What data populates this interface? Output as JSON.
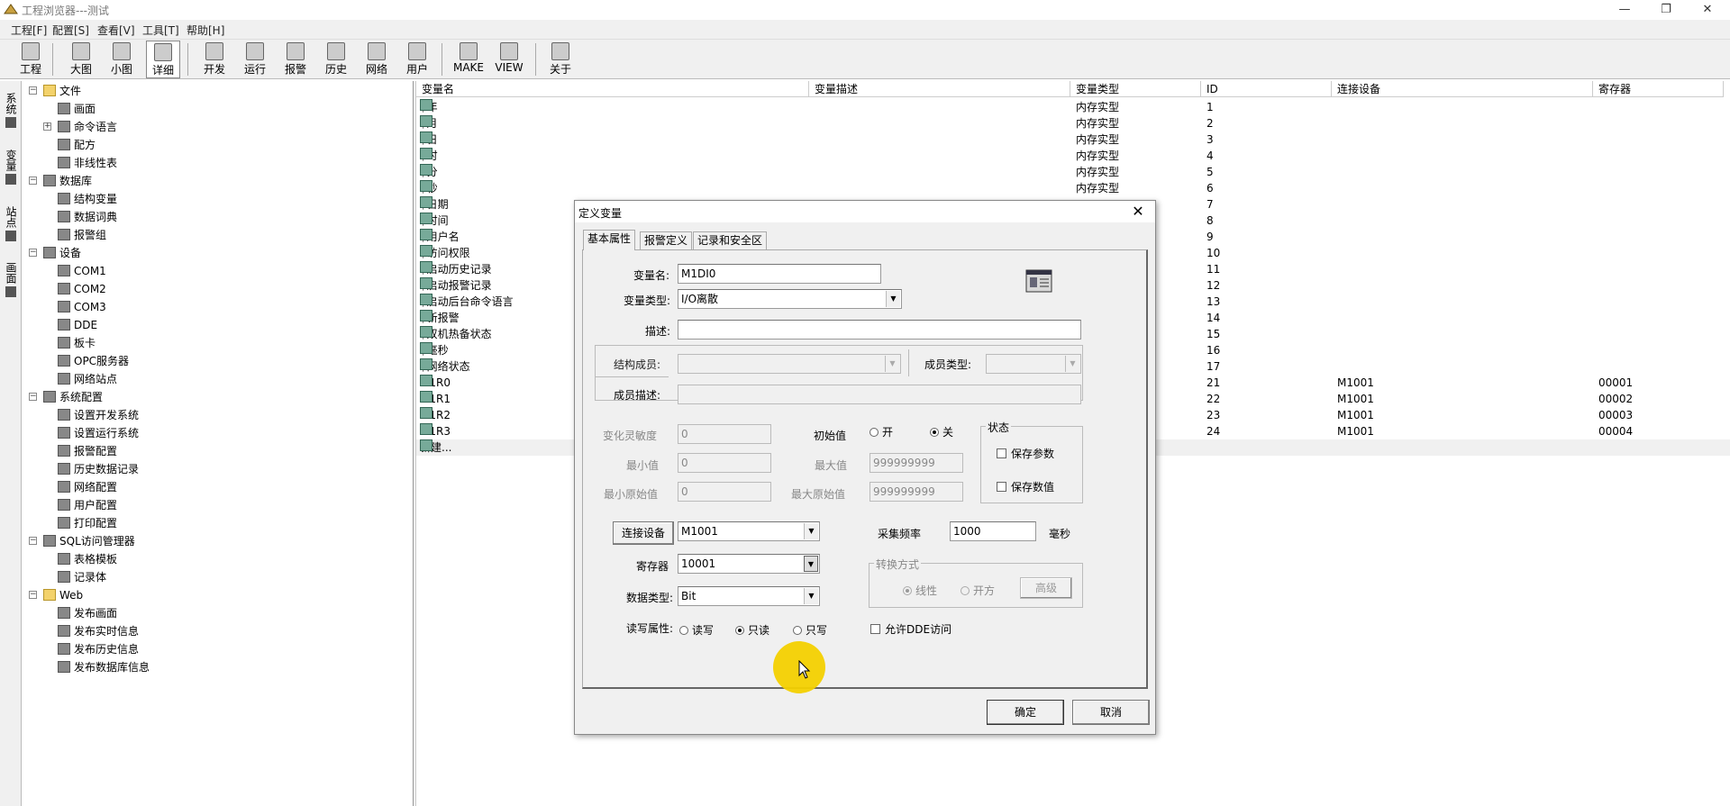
{
  "window": {
    "title": "工程浏览器---测试",
    "controls": [
      "minimize",
      "restore",
      "close"
    ]
  },
  "menu": [
    "工程[F]",
    "配置[S]",
    "查看[V]",
    "工具[T]",
    "帮助[H]"
  ],
  "toolbar": [
    "工程",
    "大图",
    "小图",
    "详细",
    "开发",
    "运行",
    "报警",
    "历史",
    "网络",
    "用户",
    "MAKE",
    "VIEW",
    "关于"
  ],
  "toolbar_active": "详细",
  "vtabs": [
    "系统",
    "变量",
    "站点",
    "画面"
  ],
  "tree": [
    {
      "label": "文件",
      "level": 0,
      "expander": "−",
      "icon": "folder-icon"
    },
    {
      "label": "画面",
      "level": 1,
      "icon": "screen-icon"
    },
    {
      "label": "命令语言",
      "level": 1,
      "expander": "+",
      "icon": "script-icon"
    },
    {
      "label": "配方",
      "level": 1,
      "icon": "recipe-icon"
    },
    {
      "label": "非线性表",
      "level": 1,
      "icon": "table-icon"
    },
    {
      "label": "数据库",
      "level": 0,
      "expander": "−",
      "icon": "database-icon"
    },
    {
      "label": "结构变量",
      "level": 1,
      "icon": "struct-icon"
    },
    {
      "label": "数据词典",
      "level": 1,
      "icon": "dictionary-icon"
    },
    {
      "label": "报警组",
      "level": 1,
      "icon": "alarm-group-icon"
    },
    {
      "label": "设备",
      "level": 0,
      "expander": "−",
      "icon": "device-icon"
    },
    {
      "label": "COM1",
      "level": 1,
      "icon": "port-icon"
    },
    {
      "label": "COM2",
      "level": 1,
      "icon": "port-icon"
    },
    {
      "label": "COM3",
      "level": 1,
      "icon": "port-icon"
    },
    {
      "label": "DDE",
      "level": 1,
      "icon": "dde-icon"
    },
    {
      "label": "板卡",
      "level": 1,
      "icon": "board-icon"
    },
    {
      "label": "OPC服务器",
      "level": 1,
      "icon": "opc-icon"
    },
    {
      "label": "网络站点",
      "level": 1,
      "icon": "network-icon"
    },
    {
      "label": "系统配置",
      "level": 0,
      "expander": "−",
      "icon": "tools-icon"
    },
    {
      "label": "设置开发系统",
      "level": 1,
      "icon": "dev-config-icon"
    },
    {
      "label": "设置运行系统",
      "level": 1,
      "icon": "run-config-icon"
    },
    {
      "label": "报警配置",
      "level": 1,
      "icon": "alarm-config-icon"
    },
    {
      "label": "历史数据记录",
      "level": 1,
      "icon": "history-icon"
    },
    {
      "label": "网络配置",
      "level": 1,
      "icon": "network-config-icon"
    },
    {
      "label": "用户配置",
      "level": 1,
      "icon": "user-icon"
    },
    {
      "label": "打印配置",
      "level": 1,
      "icon": "printer-icon"
    },
    {
      "label": "SQL访问管理器",
      "level": 0,
      "expander": "−",
      "icon": "sql-icon"
    },
    {
      "label": "表格模板",
      "level": 1,
      "icon": "template-icon"
    },
    {
      "label": "记录体",
      "level": 1,
      "icon": "record-icon"
    },
    {
      "label": "Web",
      "level": 0,
      "expander": "−",
      "icon": "folder-icon"
    },
    {
      "label": "发布画面",
      "level": 1,
      "icon": "publish-icon"
    },
    {
      "label": "发布实时信息",
      "level": 1,
      "icon": "publish-icon"
    },
    {
      "label": "发布历史信息",
      "level": 1,
      "icon": "publish-icon"
    },
    {
      "label": "发布数据库信息",
      "level": 1,
      "icon": "publish-db-icon"
    }
  ],
  "list": {
    "columns": [
      "变量名",
      "变量描述",
      "变量类型",
      "ID",
      "连接设备",
      "寄存器"
    ],
    "rows": [
      [
        "$年",
        "",
        "内存实型",
        "1",
        "",
        ""
      ],
      [
        "$月",
        "",
        "内存实型",
        "2",
        "",
        ""
      ],
      [
        "$日",
        "",
        "内存实型",
        "3",
        "",
        ""
      ],
      [
        "$时",
        "",
        "内存实型",
        "4",
        "",
        ""
      ],
      [
        "$分",
        "",
        "内存实型",
        "5",
        "",
        ""
      ],
      [
        "$秒",
        "",
        "内存实型",
        "6",
        "",
        ""
      ],
      [
        "$日期",
        "",
        "",
        "7",
        "",
        ""
      ],
      [
        "$时间",
        "",
        "",
        "8",
        "",
        ""
      ],
      [
        "$用户名",
        "",
        "",
        "9",
        "",
        ""
      ],
      [
        "$访问权限",
        "",
        "",
        "10",
        "",
        ""
      ],
      [
        "$启动历史记录",
        "",
        "",
        "11",
        "",
        ""
      ],
      [
        "$启动报警记录",
        "",
        "",
        "12",
        "",
        ""
      ],
      [
        "$启动后台命令语言",
        "",
        "",
        "13",
        "",
        ""
      ],
      [
        "$新报警",
        "",
        "",
        "14",
        "",
        ""
      ],
      [
        "$双机热备状态",
        "",
        "",
        "15",
        "",
        ""
      ],
      [
        "$毫秒",
        "",
        "",
        "16",
        "",
        ""
      ],
      [
        "$网络状态",
        "",
        "",
        "17",
        "",
        ""
      ],
      [
        "M1R0",
        "",
        "",
        "21",
        "M1001",
        "00001"
      ],
      [
        "M1R1",
        "",
        "",
        "22",
        "M1001",
        "00002"
      ],
      [
        "M1R2",
        "",
        "",
        "23",
        "M1001",
        "00003"
      ],
      [
        "M1R3",
        "",
        "",
        "24",
        "M1001",
        "00004"
      ]
    ],
    "new_row": "新建..."
  },
  "dialog": {
    "title": "定义变量",
    "tabs": [
      "基本属性",
      "报警定义",
      "记录和安全区"
    ],
    "var_name_label": "变量名:",
    "var_name": "M1DI0",
    "var_type_label": "变量类型:",
    "var_type": "I/O离散",
    "desc_label": "描述:",
    "desc": "",
    "struct_member_label": "结构成员:",
    "member_type_label": "成员类型:",
    "member_desc_label": "成员描述:",
    "sensitivity_label": "变化灵敏度",
    "sensitivity": "0",
    "min_label": "最小值",
    "min": "0",
    "min_raw_label": "最小原始值",
    "min_raw": "0",
    "initial_label": "初始值",
    "initial_on": "开",
    "initial_off": "关",
    "initial_selected": "关",
    "max_label": "最大值",
    "max": "999999999",
    "max_raw_label": "最大原始值",
    "max_raw": "999999999",
    "status_group": "状态",
    "save_params": "保存参数",
    "save_value": "保存数值",
    "connect_device_btn": "连接设备",
    "device": "M1001",
    "sample_rate_label": "采集频率",
    "sample_rate": "1000",
    "sample_unit": "毫秒",
    "register_label": "寄存器",
    "register": "10001",
    "convert_group": "转换方式",
    "convert_linear": "线性",
    "convert_sqrt": "开方",
    "advanced_btn": "高级",
    "data_type_label": "数据类型:",
    "data_type": "Bit",
    "rw_label": "读写属性:",
    "rw_options": [
      "读写",
      "只读",
      "只写"
    ],
    "rw_selected": "只读",
    "allow_dde": "允许DDE访问",
    "ok": "确定",
    "cancel": "取消"
  }
}
